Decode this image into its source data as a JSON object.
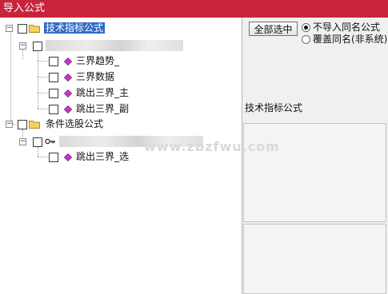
{
  "window": {
    "title": "导入公式"
  },
  "tree": {
    "group1": {
      "label": "技术指标公式",
      "items": [
        "三界趋势_",
        "三界数据",
        "跳出三界_主",
        "跳出三界_副"
      ]
    },
    "group2": {
      "label": "条件选股公式",
      "items": [
        "跳出三界_选"
      ]
    }
  },
  "panel": {
    "select_all_label": "全部选中",
    "radio_options": [
      {
        "label": "不导入同名公式",
        "selected": true
      },
      {
        "label": "覆盖同名(非系统)",
        "selected": false
      }
    ],
    "section_label": "技术指标公式"
  },
  "watermark": "www.zbzfwu.com",
  "icons": {
    "folder": "folder-icon",
    "formula": "formula-diamond-icon",
    "key": "key-icon"
  },
  "colors": {
    "titlebar": "#c8233a",
    "selection": "#3169c6",
    "diamond": "#cc33cc",
    "folder": "#f5d25c"
  }
}
